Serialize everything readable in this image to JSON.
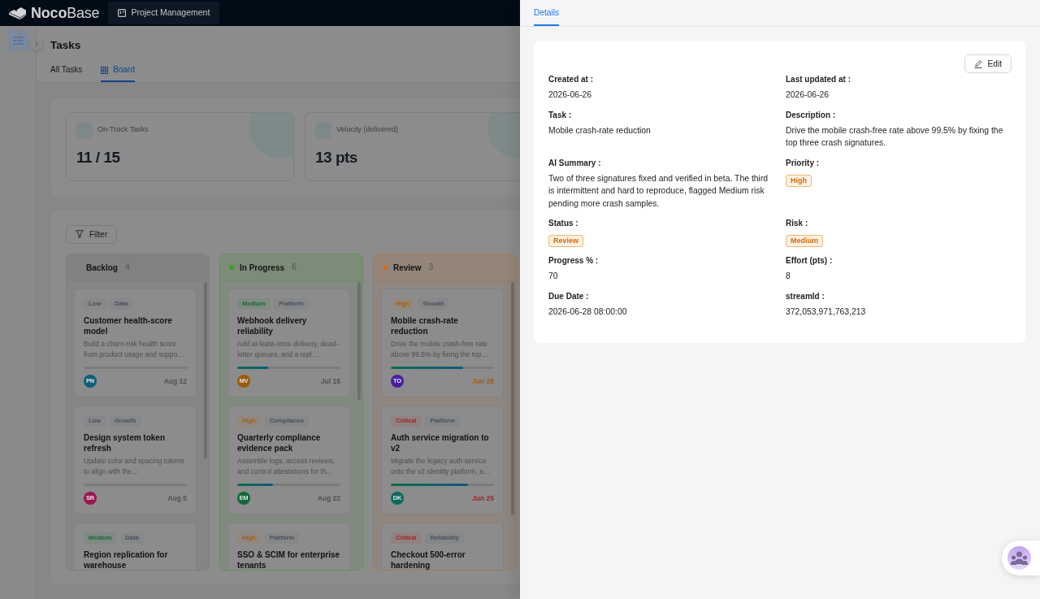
{
  "header": {
    "logo": "**Noco**Base",
    "nav": [
      {
        "label": "Project Management",
        "selected": true
      }
    ]
  },
  "page": {
    "title": "Tasks",
    "tabs": [
      {
        "label": "All Tasks",
        "kind": "plain",
        "selected": false
      },
      {
        "label": "Board",
        "kind": "board",
        "selected": true
      }
    ]
  },
  "stats": [
    {
      "label": "On-Track Tasks",
      "value": "11 / 15"
    },
    {
      "label": "Velocity (delivered)",
      "value": "13 pts"
    }
  ],
  "board": {
    "filter_button": "Filter",
    "columns": [
      {
        "title": "Backlog",
        "count": "4",
        "cards": [
          {
            "tags": [
              {
                "label": "Low",
                "color": "#47505c"
              },
              {
                "label": "Data",
                "color": "#47505c"
              }
            ],
            "title": "Customer health-score model",
            "description": "Build a churn-risk health score from product usage and suppo…",
            "level": 0,
            "avatar": {
              "initials": "PN",
              "color": "#0c5f78"
            },
            "due": {
              "label": "Aug 12",
              "color": "#505050"
            }
          },
          {
            "tags": [
              {
                "label": "Low",
                "color": "#47505c"
              },
              {
                "label": "Growth",
                "color": "#47505c"
              }
            ],
            "title": "Design system token refresh",
            "description": "Update color and spacing tokens to align with the…",
            "level": 0,
            "avatar": {
              "initials": "SR",
              "color": "#9c1550"
            },
            "due": {
              "label": "Aug 5",
              "color": "#505050"
            }
          },
          {
            "tags": [
              {
                "label": "Medium",
                "color": "#16683a"
              },
              {
                "label": "Data",
                "color": "#47505c"
              }
            ],
            "title": "Region replication for warehouse"
          }
        ]
      },
      {
        "title": "In Progress",
        "count": "6",
        "color": "#3f9a2a",
        "cards": [
          {
            "tags": [
              {
                "label": "Medium",
                "color": "#16683a"
              },
              {
                "label": "Platform",
                "color": "#47505c"
              }
            ],
            "title": "Webhook delivery reliability",
            "description": "Add at-least-once delivery, dead-letter queues, and a repl…",
            "level": 0.3,
            "avatar": {
              "initials": "MV",
              "color": "#9a5a08"
            },
            "due": {
              "label": "Jul 15",
              "color": "#505050"
            }
          },
          {
            "tags": [
              {
                "label": "High",
                "color": "#a55c12"
              },
              {
                "label": "Compliance",
                "color": "#47505c"
              }
            ],
            "title": "Quarterly compliance evidence pack",
            "description": "Assemble logs, access reviews, and control attestations for th…",
            "level": 0.35,
            "avatar": {
              "initials": "EM",
              "color": "#0c6b3c"
            },
            "due": {
              "label": "Aug 22",
              "color": "#505050"
            }
          },
          {
            "tags": [
              {
                "label": "High",
                "color": "#a55c12"
              },
              {
                "label": "Platform",
                "color": "#47505c"
              }
            ],
            "title": "SSO & SCIM for enterprise tenants"
          }
        ]
      },
      {
        "title": "Review",
        "count": "3",
        "color": "#c8702a",
        "cards": [
          {
            "tags": [
              {
                "label": "High",
                "color": "#a55c12"
              },
              {
                "label": "Growth",
                "color": "#47505c"
              }
            ],
            "title": "Mobile crash-rate reduction",
            "description": "Drive the mobile crash-free rate above 99.5% by fixing the top…",
            "level": 0.7,
            "avatar": {
              "initials": "TO",
              "color": "#4a1fa0"
            },
            "due": {
              "label": "Jun 28",
              "color": "#a85a0c"
            }
          },
          {
            "tags": [
              {
                "label": "Critical",
                "color": "#a32222"
              },
              {
                "label": "Platform",
                "color": "#47505c"
              }
            ],
            "title": "Auth service migration to v2",
            "description": "Migrate the legacy auth service onto the v2 identity platform, a…",
            "level": 0.75,
            "avatar": {
              "initials": "DK",
              "color": "#0b6a5c"
            },
            "due": {
              "label": "Jun 25",
              "color": "#a32222"
            }
          },
          {
            "tags": [
              {
                "label": "Critical",
                "color": "#a32222"
              },
              {
                "label": "Reliability",
                "color": "#47505c"
              }
            ],
            "title": "Checkout 500-error hardening"
          }
        ]
      }
    ]
  },
  "details": {
    "tabs": [
      {
        "label": "Details",
        "selected": true
      }
    ],
    "edit_button": "Edit",
    "fields": [
      {
        "label": "Created at :",
        "kind": "text",
        "value": "2026-06-26"
      },
      {
        "label": "Last updated at :",
        "kind": "text",
        "value": "2026-06-26"
      },
      {
        "label": "Task :",
        "kind": "text",
        "value": "Mobile crash-rate reduction"
      },
      {
        "label": "Description :",
        "kind": "text",
        "value": "Drive the mobile crash-free rate above 99.5% by fixing the top three crash signatures."
      },
      {
        "label": "AI Summary :",
        "kind": "text",
        "value": "Two of three signatures fixed and verified in beta. The third is intermittent and hard to reproduce, flagged Medium risk pending more crash samples."
      },
      {
        "label": "Priority :",
        "kind": "tag",
        "value": "High",
        "color": "#d46b08"
      },
      {
        "label": "Status :",
        "kind": "tag",
        "value": "Review",
        "color": "#d46b08"
      },
      {
        "label": "Risk :",
        "kind": "tag",
        "value": "Medium",
        "color": "#d46b08"
      },
      {
        "label": "Progress % :",
        "kind": "text",
        "value": "70"
      },
      {
        "label": "Effort (pts) :",
        "kind": "text",
        "value": "8"
      },
      {
        "label": "Due Date :",
        "kind": "text",
        "value": "2026-06-28 08:00:00"
      },
      {
        "label": "streamId :",
        "kind": "text",
        "value": "372,053,971,763,213"
      }
    ]
  }
}
